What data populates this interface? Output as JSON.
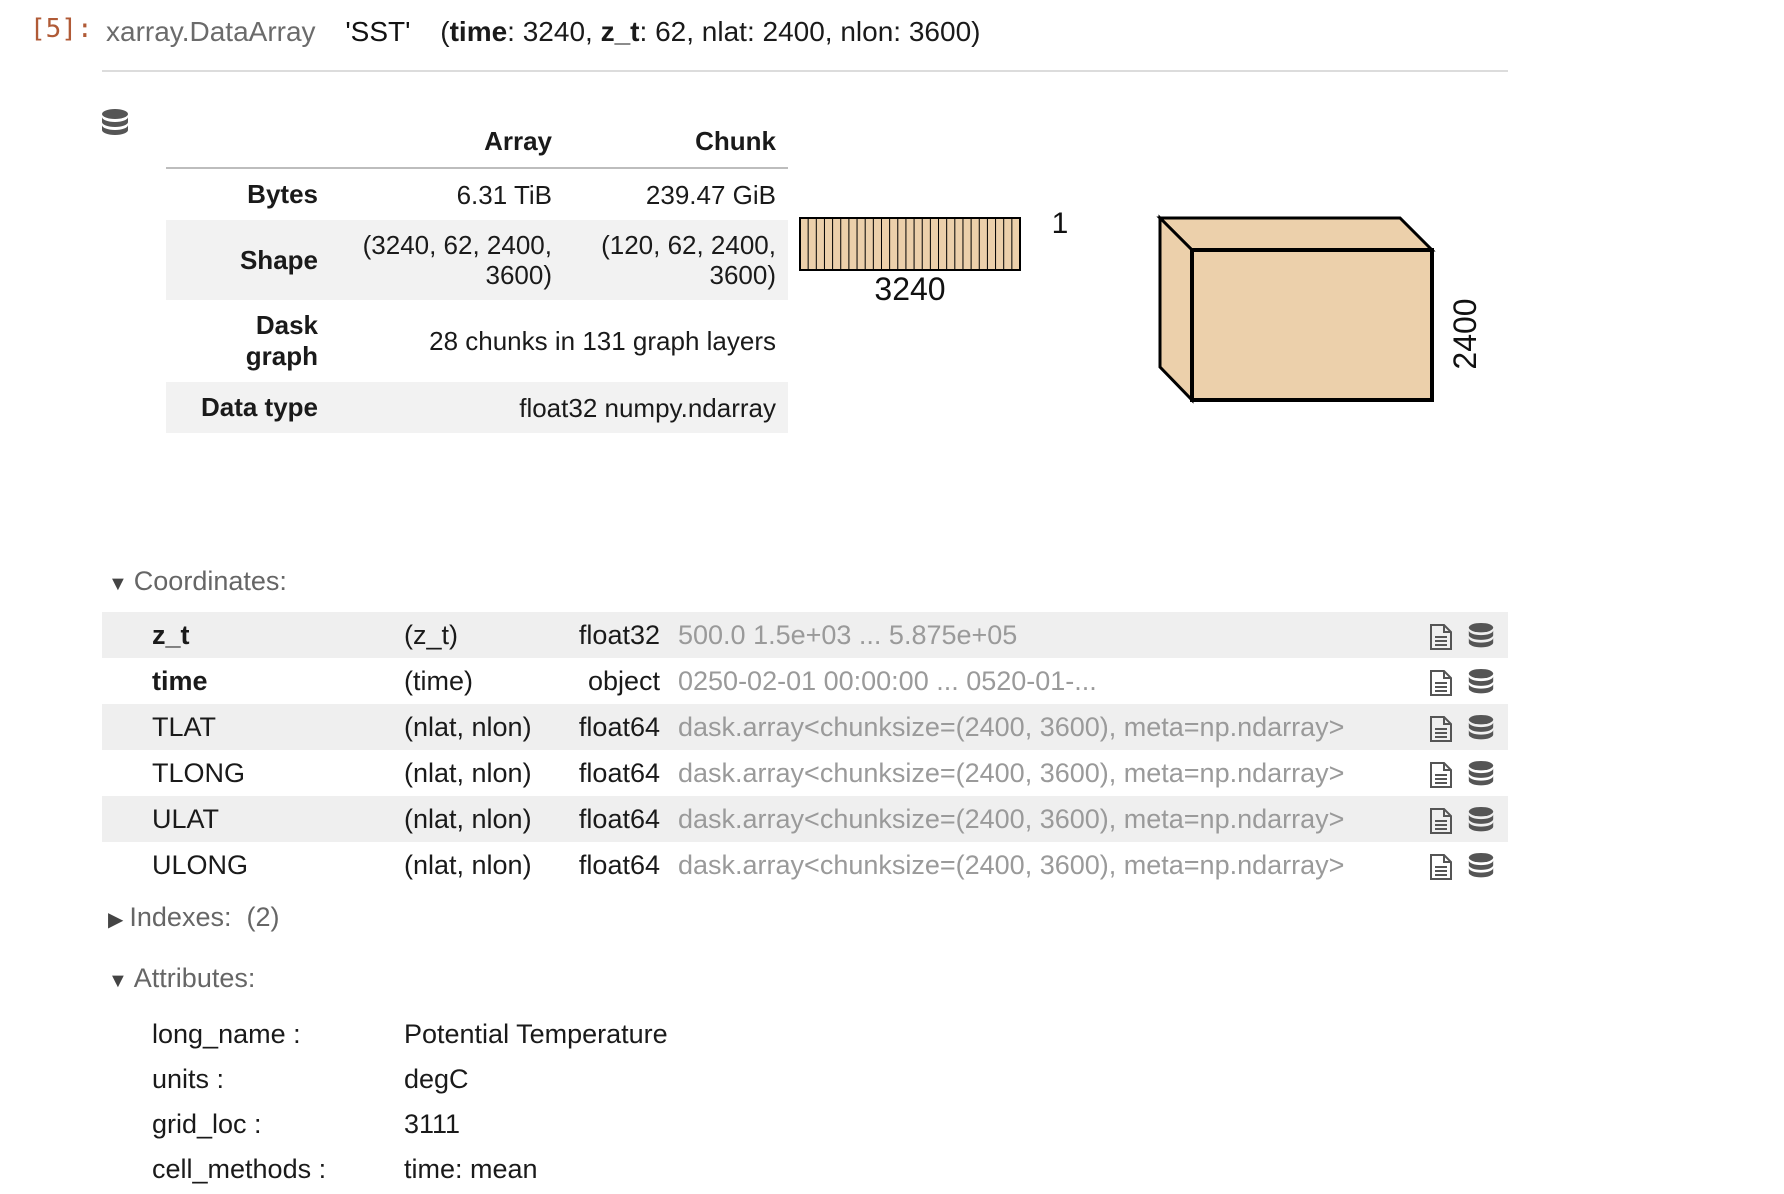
{
  "cell": {
    "prompt": "[5]:",
    "object_type": "xarray.DataArray",
    "var_name": "'SST'",
    "dims": [
      {
        "name": "time",
        "size": "3240"
      },
      {
        "name": "z_t",
        "size": "62"
      },
      {
        "name": "nlat",
        "size": "2400"
      },
      {
        "name": "nlon",
        "size": "3600"
      }
    ]
  },
  "dask_table": {
    "col_array": "Array",
    "col_chunk": "Chunk",
    "rows": [
      {
        "label": "Bytes",
        "array": "6.31 TiB",
        "chunk": "239.47 GiB"
      },
      {
        "label": "Shape",
        "array": "(3240, 62, 2400, 3600)",
        "chunk": "(120, 62, 2400, 3600)"
      },
      {
        "label": "Dask graph",
        "merged": "28 chunks in 131 graph layers"
      },
      {
        "label": "Data type",
        "merged": "float32 numpy.ndarray"
      }
    ]
  },
  "chunk_viz": {
    "label_time": "3240",
    "label_one": "1",
    "label_nlat": "2400",
    "fill_color": "#ecd0ab",
    "time_chunks": 27
  },
  "coordinates": {
    "title": "Coordinates:",
    "items": [
      {
        "name": "z_t",
        "dims": "(z_t)",
        "dtype": "float32",
        "preview": "500.0 1.5e+03 ... 5.875e+05",
        "index": true
      },
      {
        "name": "time",
        "dims": "(time)",
        "dtype": "object",
        "preview": "0250-02-01 00:00:00 ... 0520-01-...",
        "index": true
      },
      {
        "name": "TLAT",
        "dims": "(nlat, nlon)",
        "dtype": "float64",
        "preview": "dask.array<chunksize=(2400, 3600), meta=np.ndarray>",
        "index": false
      },
      {
        "name": "TLONG",
        "dims": "(nlat, nlon)",
        "dtype": "float64",
        "preview": "dask.array<chunksize=(2400, 3600), meta=np.ndarray>",
        "index": false
      },
      {
        "name": "ULAT",
        "dims": "(nlat, nlon)",
        "dtype": "float64",
        "preview": "dask.array<chunksize=(2400, 3600), meta=np.ndarray>",
        "index": false
      },
      {
        "name": "ULONG",
        "dims": "(nlat, nlon)",
        "dtype": "float64",
        "preview": "dask.array<chunksize=(2400, 3600), meta=np.ndarray>",
        "index": false
      }
    ]
  },
  "indexes": {
    "title": "Indexes:",
    "count": "(2)"
  },
  "attributes": {
    "title": "Attributes:",
    "items": [
      {
        "key": "long_name :",
        "value": "Potential Temperature"
      },
      {
        "key": "units :",
        "value": "degC"
      },
      {
        "key": "grid_loc :",
        "value": "3111"
      },
      {
        "key": "cell_methods :",
        "value": "time: mean"
      }
    ]
  },
  "icons": {
    "database": "database-icon",
    "file": "file-text-icon"
  }
}
